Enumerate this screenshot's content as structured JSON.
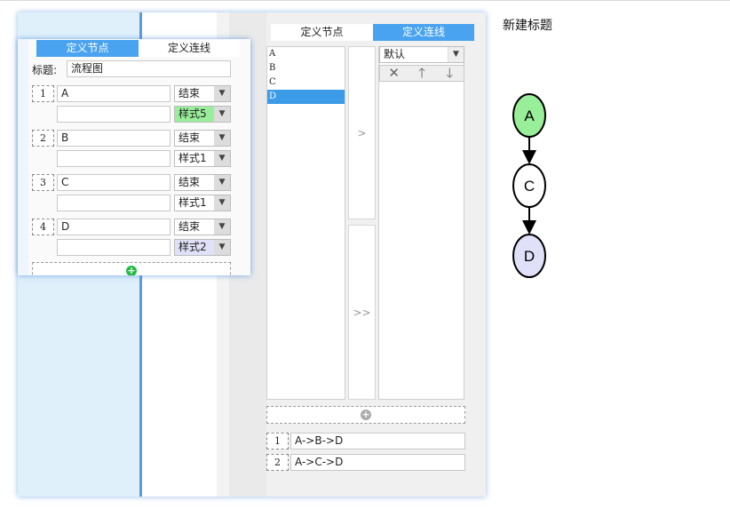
{
  "preview": {
    "title": "新建标题",
    "nodes": [
      {
        "label": "A",
        "fill": "#99ee99"
      },
      {
        "label": "C",
        "fill": "#ffffff"
      },
      {
        "label": "D",
        "fill": "#e0e0f8"
      }
    ]
  },
  "front": {
    "tabs": [
      {
        "label": "定义节点",
        "active": true
      },
      {
        "label": "定义连线",
        "active": false
      }
    ],
    "title_label": "标题:",
    "title_value": "流程图",
    "nodes": [
      {
        "index": "1",
        "name": "A",
        "type": "结束",
        "desc": "",
        "style": "样式5",
        "style_color": "#99ee99"
      },
      {
        "index": "2",
        "name": "B",
        "type": "结束",
        "desc": "",
        "style": "样式1",
        "style_color": "#ffffff"
      },
      {
        "index": "3",
        "name": "C",
        "type": "结束",
        "desc": "",
        "style": "样式1",
        "style_color": "#ffffff"
      },
      {
        "index": "4",
        "name": "D",
        "type": "结束",
        "desc": "",
        "style": "样式2",
        "style_color": "#e0e0f8"
      }
    ]
  },
  "back": {
    "tabs": [
      {
        "label": "定义节点",
        "active": false
      },
      {
        "label": "定义连线",
        "active": true
      }
    ],
    "node_list": [
      {
        "label": "A",
        "selected": false
      },
      {
        "label": "B",
        "selected": false
      },
      {
        "label": "C",
        "selected": false
      },
      {
        "label": "D",
        "selected": true
      }
    ],
    "move_one": ">",
    "move_all": ">>",
    "style_select": "默认",
    "tools": {
      "delete": "✕",
      "up": "🡑",
      "down": "🡓"
    },
    "paths": [
      {
        "index": "1",
        "value": "A->B->D"
      },
      {
        "index": "2",
        "value": "A->C->D"
      }
    ]
  },
  "colors": {
    "accent": "#4aa3f0",
    "add_green": "#22bb44",
    "add_grey": "#aaaaaa"
  }
}
